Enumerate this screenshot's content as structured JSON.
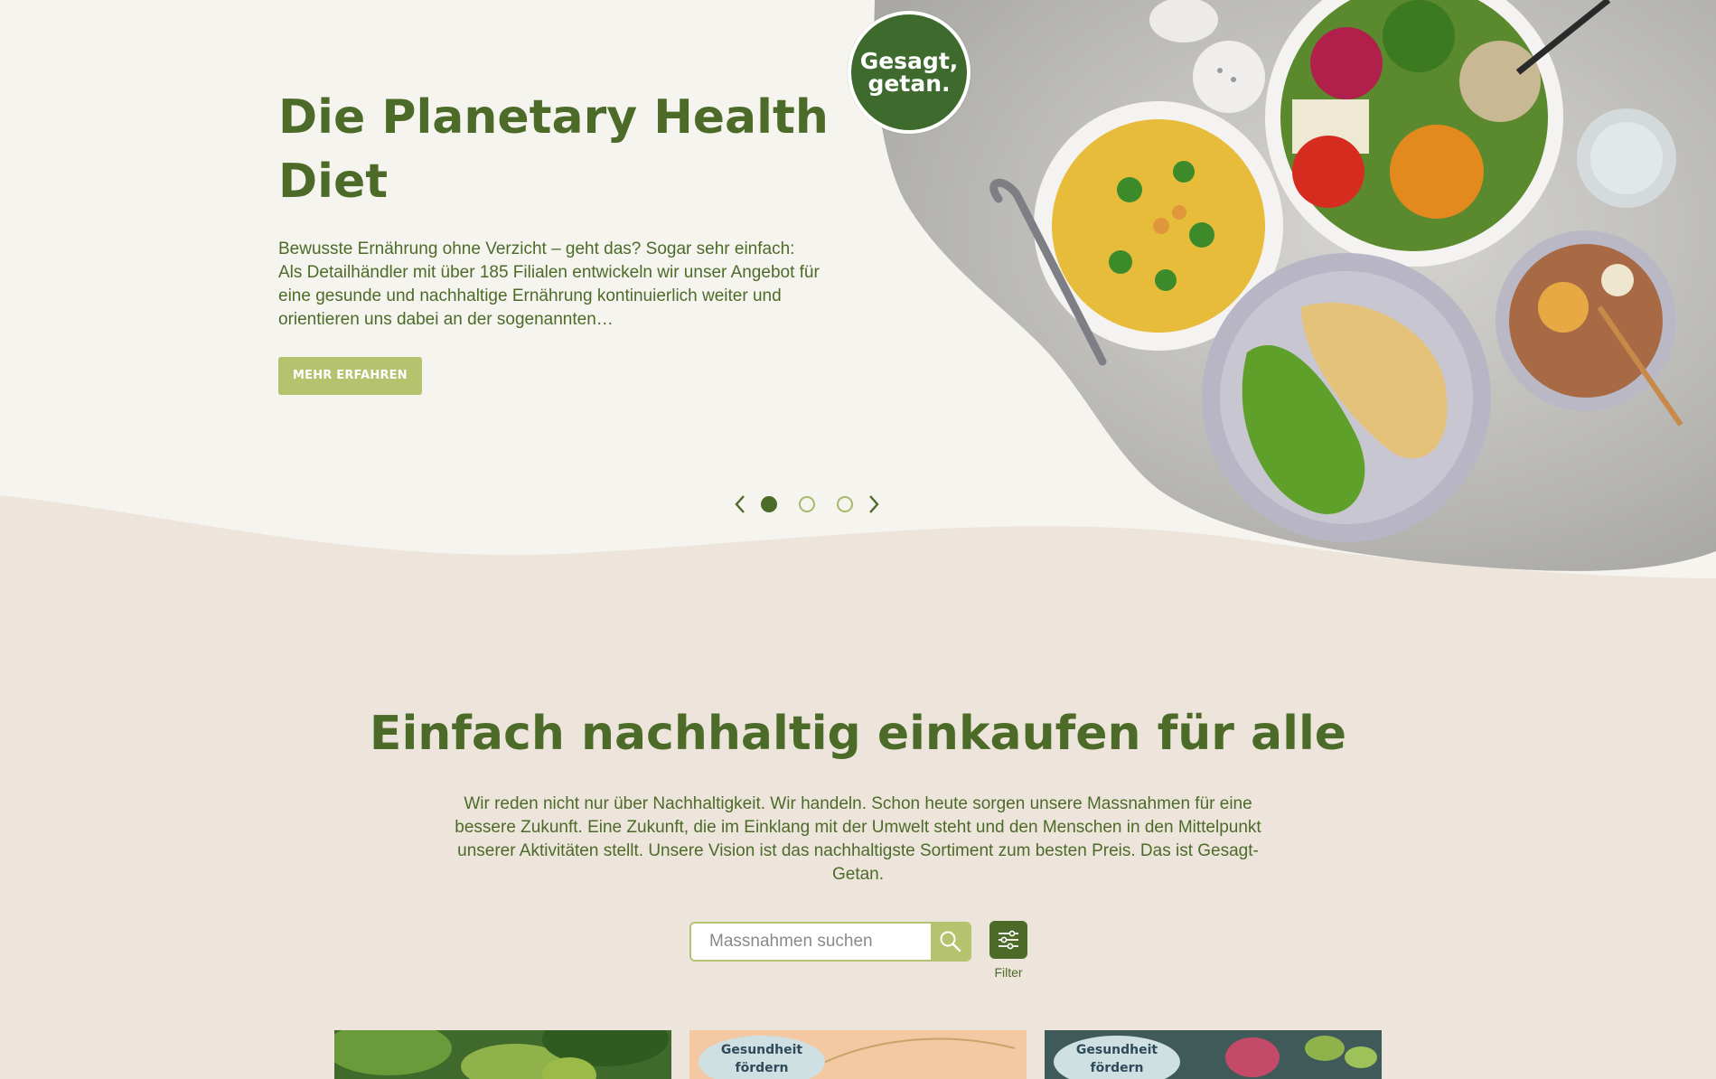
{
  "hero": {
    "title": "Die Planetary Health Diet",
    "description": "Bewusste Ernährung ohne Verzicht – geht das? Sogar sehr einfach: Als Detailhändler mit über 185 Filialen entwickeln wir unser Angebot für eine gesunde und nachhaltige Ernährung kontinuierlich weiter und orientieren uns dabei an der sogenannten…",
    "button_label": "MEHR ERFAHREN",
    "badge_line1": "Gesagt,",
    "badge_line2": "getan."
  },
  "carousel": {
    "slide_count": 3,
    "active_index": 0
  },
  "section": {
    "title": "Einfach nachhaltig einkaufen für alle",
    "description": "Wir reden nicht nur über Nachhaltigkeit. Wir handeln. Schon heute sorgen unsere Massnahmen für eine bessere Zukunft. Eine Zukunft, die im Einklang mit der Umwelt steht und den Menschen in den Mittelpunkt unserer Aktivitäten stellt. Unsere Vision ist das nachhaltigste Sortiment zum besten Preis. Das ist Gesagt-Getan."
  },
  "search": {
    "placeholder": "Massnahmen suchen",
    "filter_label": "Filter"
  },
  "cards": [
    {
      "tag": ""
    },
    {
      "tag": "Gesundheit fördern"
    },
    {
      "tag": "Gesundheit fördern"
    }
  ],
  "colors": {
    "primary_green": "#4c6b28",
    "accent_olive": "#b5c26e",
    "hero_bg": "#f6f4ef",
    "page_bg": "#ede5dc",
    "badge_green": "#3e6b2d"
  }
}
